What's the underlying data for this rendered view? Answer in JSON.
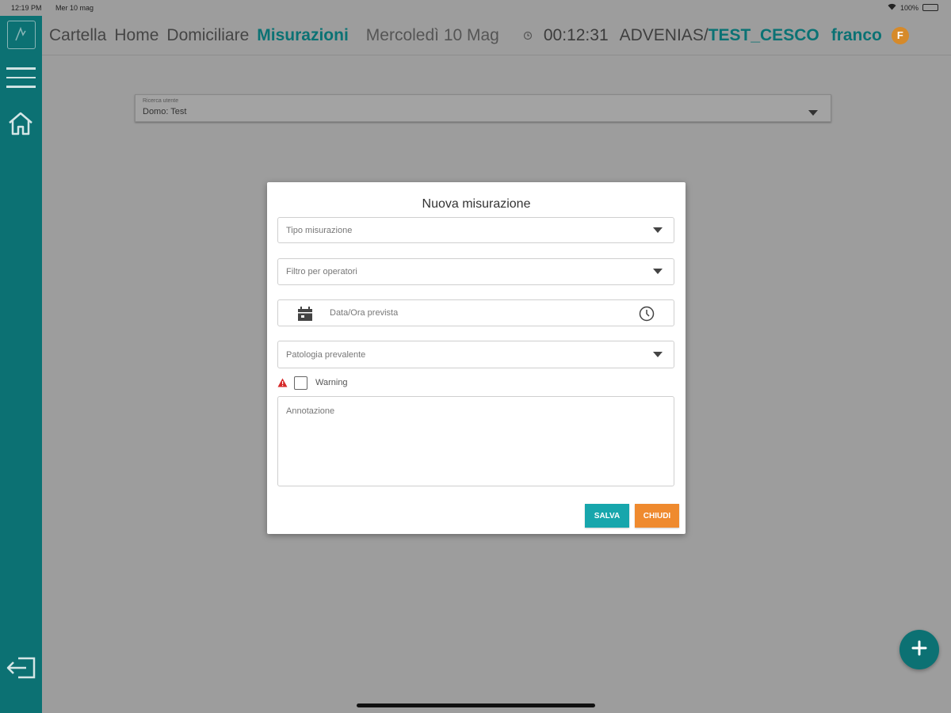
{
  "status_bar": {
    "time": "12:19 PM",
    "date": "Mer 10 mag",
    "battery": "100%"
  },
  "header": {
    "breadcrumbs": [
      "Cartella",
      "Home",
      "Domiciliare",
      "Misurazioni"
    ],
    "date": "Mercoledì 10 Mag",
    "timer": "00:12:31",
    "org": "ADVENIAS",
    "separator": "/",
    "unit": "TEST_CESCO",
    "user": "franco",
    "avatar_initial": "F"
  },
  "patient_search": {
    "label": "Ricerca utente",
    "value": "Domo: Test"
  },
  "modal": {
    "title": "Nuova misurazione",
    "fields": {
      "type": "Tipo misurazione",
      "operators": "Filtro per operatori",
      "datetime": "Data/Ora prevista",
      "pathology": "Patologia prevalente"
    },
    "warning_label": "Warning",
    "annotation_placeholder": "Annotazione",
    "save_label": "SALVA",
    "close_label": "CHIUDI"
  },
  "icons": {
    "logo": "logo-icon",
    "menu": "hamburger-icon",
    "home": "home-icon",
    "logout": "logout-icon",
    "clock": "clock-icon",
    "calendar": "calendar-icon",
    "warning": "warning-icon",
    "add": "plus-icon"
  },
  "colors": {
    "primary": "#0c7173",
    "save_button": "#17a6ac",
    "close_button": "#ef8a2e",
    "avatar": "#d68a2a",
    "warning": "#d62a2a"
  }
}
